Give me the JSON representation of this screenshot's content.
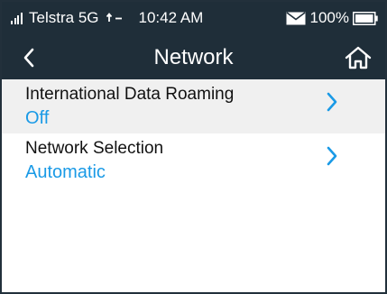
{
  "status_bar": {
    "carrier": "Telstra",
    "network_type": "5G",
    "time": "10:42 AM",
    "battery_percent": "100%"
  },
  "nav": {
    "title": "Network"
  },
  "menu": {
    "items": [
      {
        "label": "International Data Roaming",
        "value": "Off"
      },
      {
        "label": "Network Selection",
        "value": "Automatic"
      }
    ]
  },
  "colors": {
    "header_bg": "#1f2e39",
    "accent": "#1a9ae6",
    "selected_row_bg": "#f0f0f0"
  },
  "icons": {
    "signal": "signal-strength-icon",
    "data": "data-transfer-icon",
    "mail": "mail-icon",
    "battery": "battery-icon",
    "back": "back-chevron-icon",
    "home": "home-icon",
    "chevron": "chevron-right-icon"
  }
}
